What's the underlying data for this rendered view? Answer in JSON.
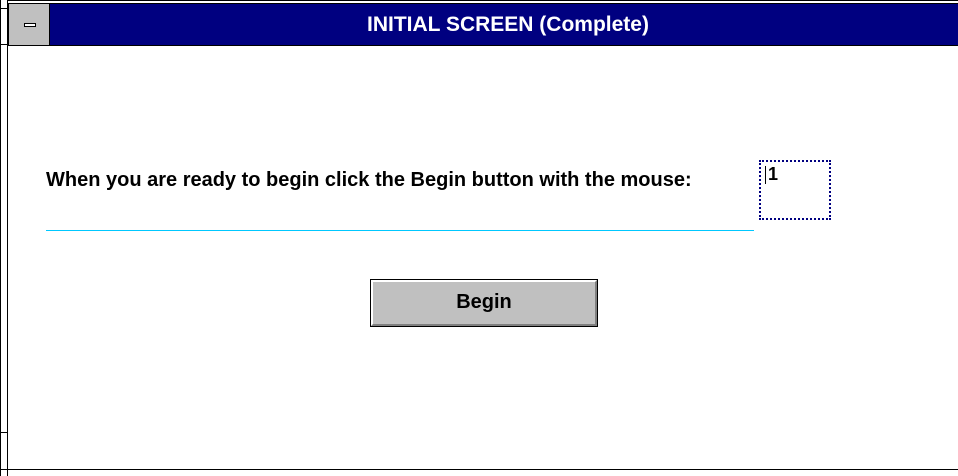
{
  "window": {
    "title": "INITIAL SCREEN (Complete)"
  },
  "content": {
    "prompt_text": "When you are ready to begin click the Begin button with the mouse:",
    "entry_value": "1",
    "begin_label": "Begin"
  },
  "colors": {
    "titlebar": "#000080",
    "title_text": "#ffffff",
    "rule": "#00c8ff",
    "button_face": "#c0c0c0"
  }
}
